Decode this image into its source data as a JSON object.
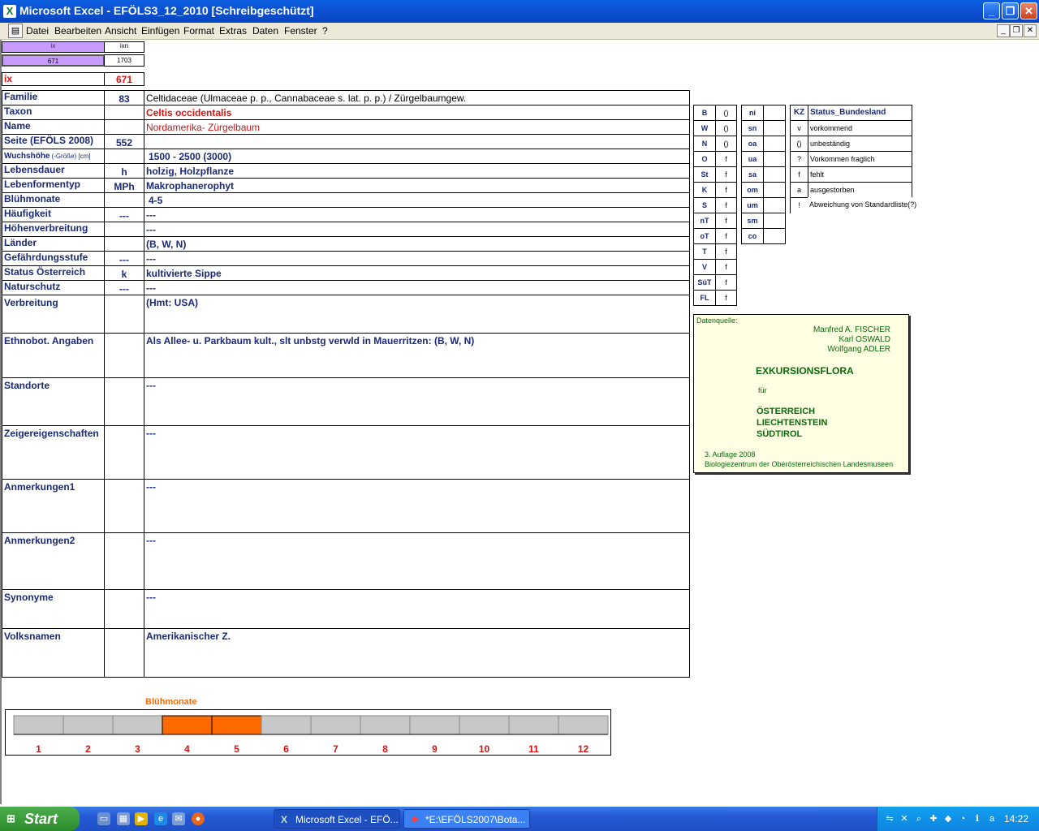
{
  "window": {
    "title": "Microsoft Excel - EFÖLS3_12_2010  [Schreibgeschützt]"
  },
  "menu": [
    "Datei",
    "Bearbeiten",
    "Ansicht",
    "Einfügen",
    "Format",
    "Extras",
    "Daten",
    "Fenster",
    "?"
  ],
  "index": {
    "h1": "ix",
    "h2": "ixn",
    "v1": "671",
    "v2": "1703",
    "ix_label": "ix",
    "ix_value": "671"
  },
  "rows": [
    {
      "label": "Familie",
      "code": "83",
      "value": "Celtidaceae (Ulmaceae p. p., Cannabaceae s. lat. p. p.)  /  Zürgelbaumgew."
    },
    {
      "label": "Taxon",
      "code": "",
      "value": "Celtis occidentalis"
    },
    {
      "label": "Name",
      "code": "",
      "value": "Nordamerika- Zürgelbaum"
    },
    {
      "label": "Seite (EFÖLS 2008)",
      "code": "552",
      "value": ""
    },
    {
      "label": "Wuchshöhe",
      "label_small": "(-Größe) [cm]",
      "code": "",
      "value": "1500 - 2500 (3000)"
    },
    {
      "label": "Lebensdauer",
      "code": "h",
      "value": "holzig, Holzpflanze"
    },
    {
      "label": "Lebenformentyp",
      "code": "MPh",
      "value": "Makrophanerophyt"
    },
    {
      "label": "Blühmonate",
      "code": "",
      "value": "4-5"
    },
    {
      "label": "Häufigkeit",
      "code": "---",
      "value": "---"
    },
    {
      "label": "Höhenverbreitung",
      "code": "",
      "value": "---"
    },
    {
      "label": "Länder",
      "code": "",
      "value": "(B, W, N)"
    },
    {
      "label": "Gefährdungsstufe",
      "code": "---",
      "value": "---"
    },
    {
      "label": "Status Österreich",
      "code": "k",
      "value": "kultivierte Sippe"
    },
    {
      "label": "Naturschutz",
      "code": "---",
      "value": "---"
    },
    {
      "label": "Verbreitung",
      "code": "",
      "value": "(Hmt: USA)"
    },
    {
      "label": "Ethnobot. Angaben",
      "code": "",
      "value": "Als Allee- u. Parkbaum kult., slt unbstg verwld in Mauerritzen: (B, W, N)"
    },
    {
      "label": "Standorte",
      "code": "",
      "value": "---"
    },
    {
      "label": "Zeigereigenschaften",
      "code": "",
      "value": "---"
    },
    {
      "label": "Anmerkungen1",
      "code": "",
      "value": "---"
    },
    {
      "label": "Anmerkungen2",
      "code": "",
      "value": "---"
    },
    {
      "label": "Synonyme",
      "code": "",
      "value": "---"
    },
    {
      "label": "Volksnamen",
      "code": "",
      "value": "Amerikanischer Z."
    }
  ],
  "status_left": [
    {
      "k": "B",
      "v": "()"
    },
    {
      "k": "W",
      "v": "()"
    },
    {
      "k": "N",
      "v": "()"
    },
    {
      "k": "O",
      "v": "f"
    },
    {
      "k": "St",
      "v": "f"
    },
    {
      "k": "K",
      "v": "f"
    },
    {
      "k": "S",
      "v": "f"
    },
    {
      "k": "nT",
      "v": "f"
    },
    {
      "k": "oT",
      "v": "f"
    },
    {
      "k": "T",
      "v": "f"
    },
    {
      "k": "V",
      "v": "f"
    },
    {
      "k": "SüT",
      "v": "f"
    },
    {
      "k": "FL",
      "v": "f"
    }
  ],
  "status_mid": [
    "ni",
    "sn",
    "oa",
    "ua",
    "sa",
    "om",
    "um",
    "sm",
    "co"
  ],
  "status_legend": {
    "header_kz": "KZ",
    "header_label": "Status_Bundesland",
    "items": [
      {
        "k": "v",
        "v": "vorkommend"
      },
      {
        "k": "()",
        "v": "unbeständig"
      },
      {
        "k": "?",
        "v": "Vorkommen fraglich"
      },
      {
        "k": "f",
        "v": "fehlt"
      },
      {
        "k": "a",
        "v": "ausgestorben"
      },
      {
        "k": "!",
        "v": "Abweichung von Standardliste(?)"
      }
    ]
  },
  "book": {
    "source_label": "Datenquelle:",
    "authors": [
      "Manfred A. FISCHER",
      "Karl OSWALD",
      "Wolfgang ADLER"
    ],
    "title": "EXKURSIONSFLORA",
    "fuer": "für",
    "countries": [
      "ÖSTERREICH",
      "LIECHTENSTEIN",
      "SÜDTIROL"
    ],
    "edition": "3. Auflage 2008",
    "publisher": "Biologiezentrum der Oberösterreichischen Landesmuseen"
  },
  "chart_data": {
    "type": "bar",
    "title": "Blühmonate",
    "categories": [
      "1",
      "2",
      "3",
      "4",
      "5",
      "6",
      "7",
      "8",
      "9",
      "10",
      "11",
      "12"
    ],
    "values": [
      0,
      0,
      0,
      1,
      1,
      0,
      0,
      0,
      0,
      0,
      0,
      0
    ],
    "colors": {
      "active": "#ff6a00",
      "inactive": "#c8c8c8"
    }
  },
  "taskbar": {
    "start": "Start",
    "tasks": [
      "Microsoft Excel - EFÖ...",
      "*E:\\EFÖLS2007\\Bota..."
    ],
    "clock": "14:22"
  }
}
